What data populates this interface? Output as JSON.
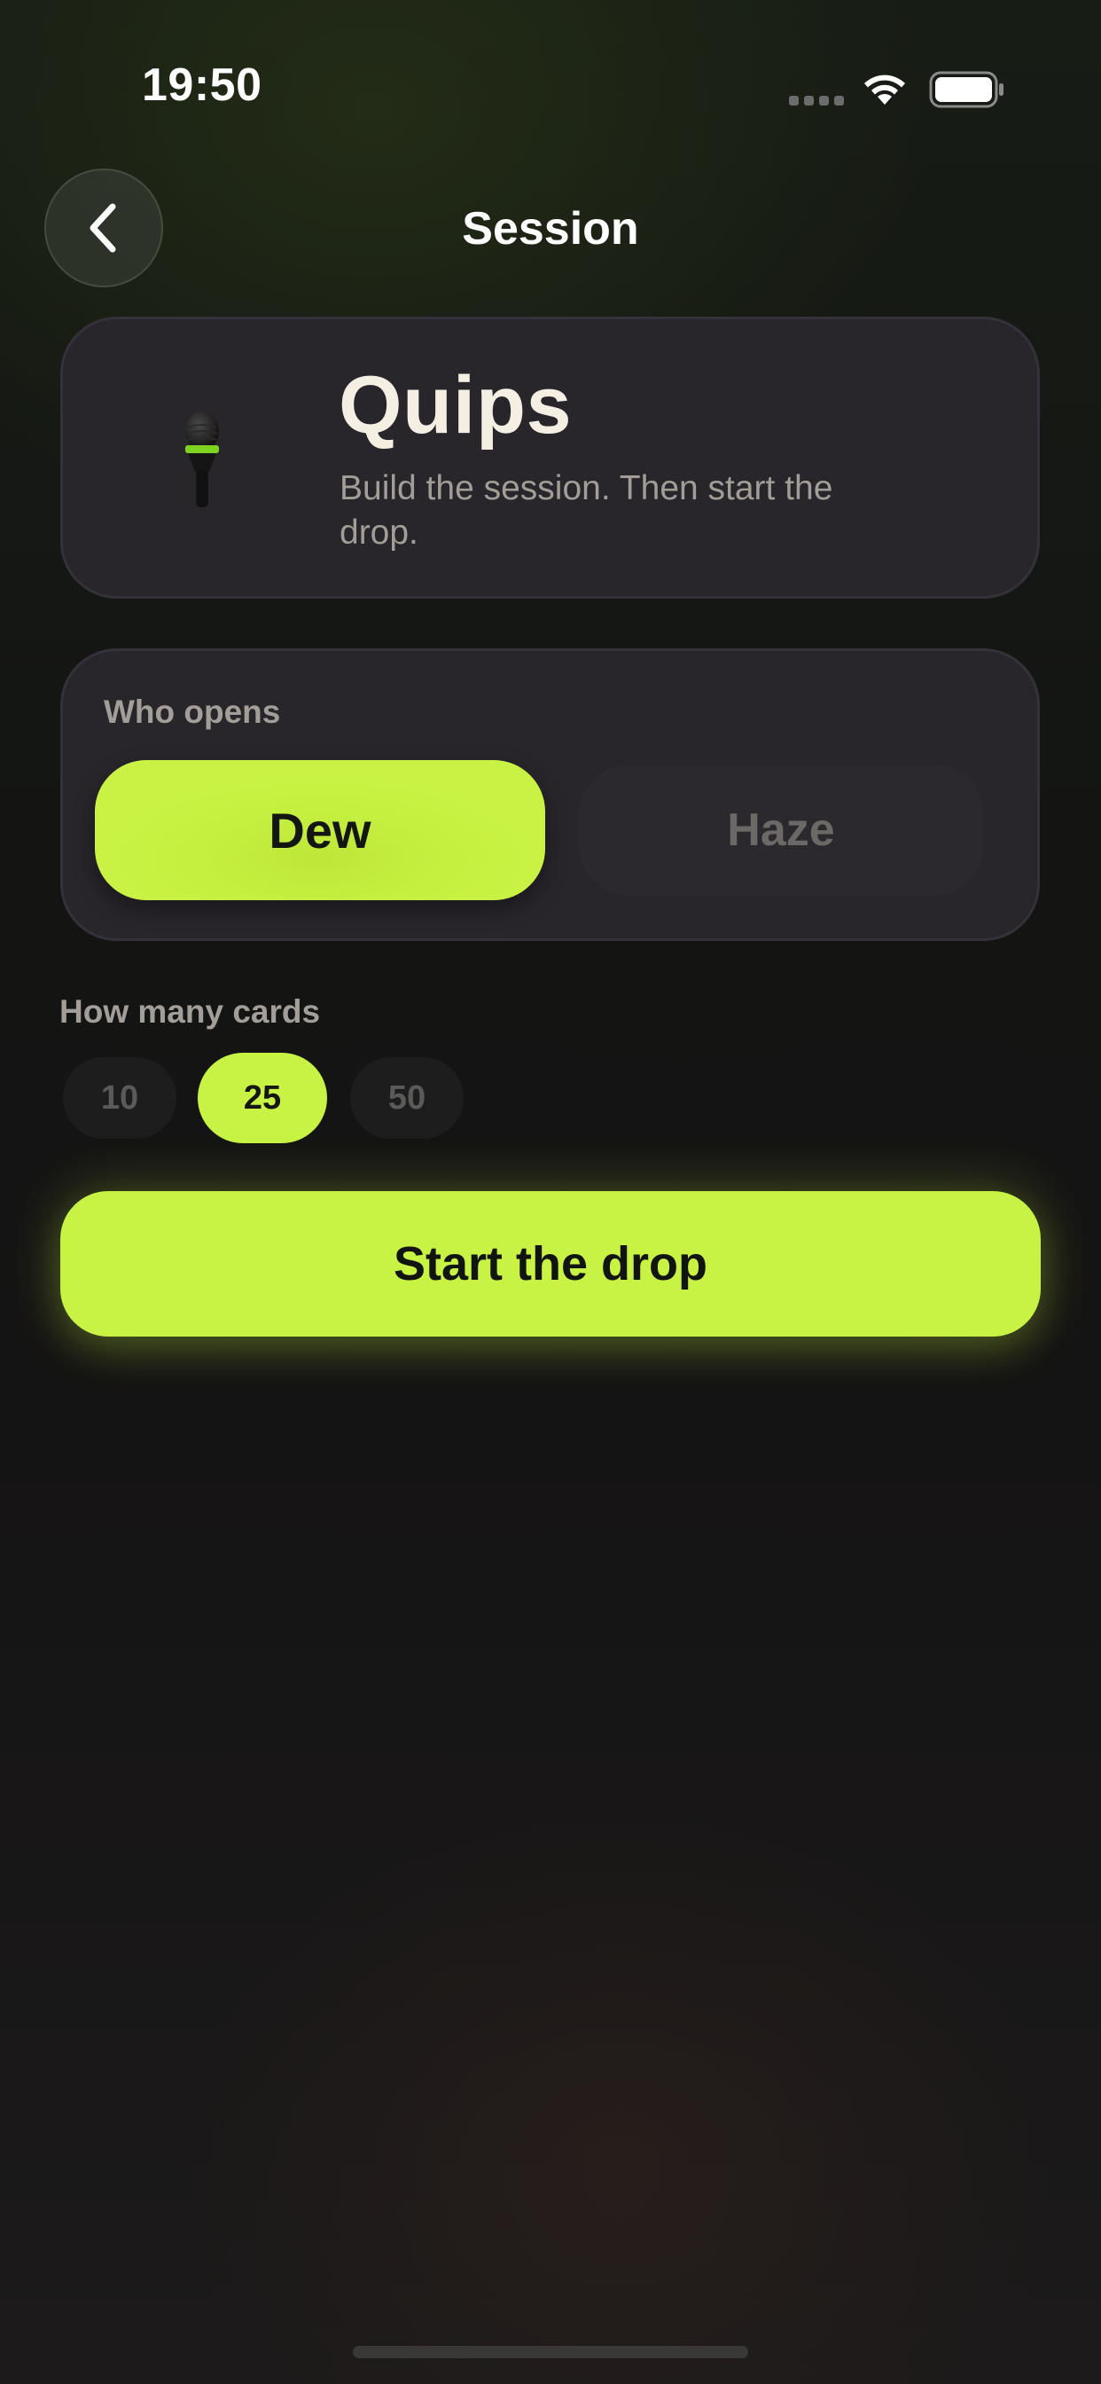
{
  "status_bar": {
    "time": "19:50"
  },
  "header": {
    "title": "Session",
    "back_icon": "chevron-left-icon"
  },
  "hero": {
    "icon": "microphone-icon",
    "title": "Quips",
    "subtitle": "Build the session. Then start the drop."
  },
  "who_opens": {
    "label": "Who opens",
    "options": [
      {
        "label": "Dew",
        "selected": true
      },
      {
        "label": "Haze",
        "selected": false
      }
    ]
  },
  "card_count": {
    "label": "How many cards",
    "options": [
      {
        "label": "10",
        "selected": false
      },
      {
        "label": "25",
        "selected": true
      },
      {
        "label": "50",
        "selected": false
      }
    ]
  },
  "start_button": {
    "label": "Start the drop"
  },
  "colors": {
    "accent": "#c8f244",
    "background": "#151414",
    "card": "#28252b"
  }
}
